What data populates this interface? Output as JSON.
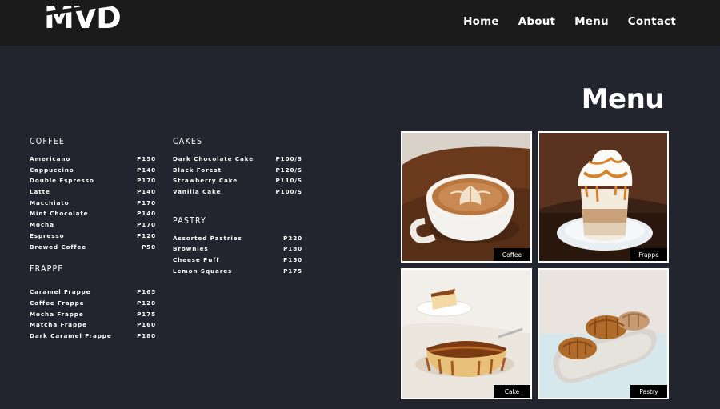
{
  "brand": {
    "logo_text": "MVD"
  },
  "nav": {
    "items": [
      {
        "label": "Home"
      },
      {
        "label": "About"
      },
      {
        "label": "Menu"
      },
      {
        "label": "Contact"
      }
    ]
  },
  "page": {
    "title": "Menu"
  },
  "menu": {
    "coffee": {
      "title": "COFFEE",
      "items": [
        {
          "name": "Americano",
          "price": "P150"
        },
        {
          "name": "Cappuccino",
          "price": "P140"
        },
        {
          "name": "Double Espresso",
          "price": "P170"
        },
        {
          "name": "Latte",
          "price": "P140"
        },
        {
          "name": "Macchiato",
          "price": "P170"
        },
        {
          "name": "Mint Chocolate",
          "price": "P140"
        },
        {
          "name": "Mocha",
          "price": "P170"
        },
        {
          "name": "Espresso",
          "price": "P120"
        },
        {
          "name": "Brewed Coffee",
          "price": "P50"
        }
      ]
    },
    "frappe": {
      "title": "FRAPPE",
      "items": [
        {
          "name": "Caramel Frappe",
          "price": "P165"
        },
        {
          "name": "Coffee Frappe",
          "price": "P120"
        },
        {
          "name": "Mocha Frappe",
          "price": "P175"
        },
        {
          "name": "Matcha Frappe",
          "price": "P160"
        },
        {
          "name": "Dark Caramel Frappe",
          "price": "P180"
        }
      ]
    },
    "cakes": {
      "title": "CAKES",
      "items": [
        {
          "name": "Dark Chocolate Cake",
          "price": "P100/S"
        },
        {
          "name": "Black Forest",
          "price": "P120/S"
        },
        {
          "name": "Strawberry Cake",
          "price": "P110/S"
        },
        {
          "name": "Vanilla Cake",
          "price": "P100/S"
        }
      ]
    },
    "pastry": {
      "title": "PASTRY",
      "items": [
        {
          "name": "Assorted Pastries",
          "price": "P220"
        },
        {
          "name": "Brownies",
          "price": "P180"
        },
        {
          "name": "Cheese Puff",
          "price": "P150"
        },
        {
          "name": "Lemon Squares",
          "price": "P175"
        }
      ]
    }
  },
  "gallery": {
    "photos": [
      {
        "label": "Coffee"
      },
      {
        "label": "Frappe"
      },
      {
        "label": "Cake"
      },
      {
        "label": "Pastry"
      }
    ]
  }
}
